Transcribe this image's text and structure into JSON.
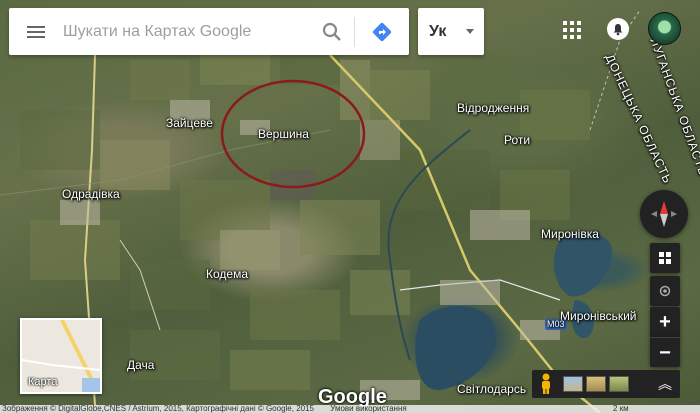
{
  "search": {
    "placeholder": "Шукати на Картах Google"
  },
  "language": {
    "label": "Ук"
  },
  "places": {
    "zaitseve": "Зайцеве",
    "vershyna": "Вершина",
    "vidrodzhennia": "Відродження",
    "roty": "Роти",
    "odradivka": "Одрадівка",
    "myronivka": "Миронівка",
    "kodema": "Кодема",
    "myronivskyi": "Миронівський",
    "dacha": "Дача",
    "svitlodarsk": "Світлодарсь",
    "road_m03": "М03"
  },
  "regions": {
    "luhansk": "ЛУГАНСЬКА ОБЛАСТЬ",
    "donetsk": "ДОНЕЦЬКА ОБЛАСТЬ"
  },
  "minimap": {
    "label": "Карта"
  },
  "logo": "Google",
  "attribution": {
    "imagery": "Зображення © DigitalGlobe,CNES / Astrium, 2015, Картографічні дані © Google, 2015",
    "terms": "Умови використання",
    "scale": "2 км"
  },
  "colors": {
    "highlight_circle": "#8b1a1a",
    "direction_blue": "#4285f4",
    "compass_red": "#e53935"
  },
  "icons": {
    "menu": "hamburger-icon",
    "search": "search-icon",
    "directions": "directions-icon",
    "apps": "apps-grid-icon",
    "notifications": "bell-icon",
    "compass": "compass-icon",
    "layers": "layers-icon",
    "location": "my-location-icon",
    "pegman": "pegman-icon",
    "expand": "expand-icon"
  }
}
